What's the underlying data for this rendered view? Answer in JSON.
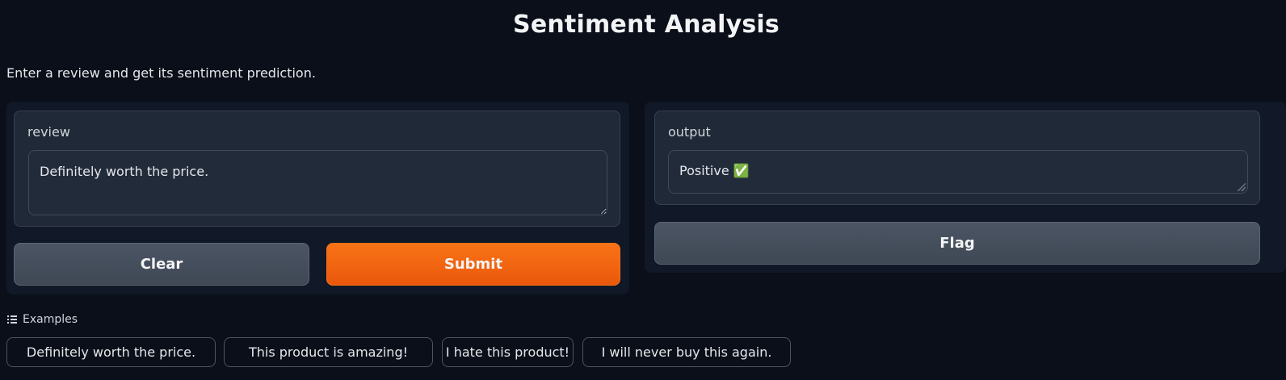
{
  "header": {
    "title": "Sentiment Analysis",
    "description": "Enter a review and get its sentiment prediction."
  },
  "input_panel": {
    "label": "review",
    "value": "Definitely worth the price.",
    "clear_label": "Clear",
    "submit_label": "Submit"
  },
  "output_panel": {
    "label": "output",
    "value": "Positive ✅",
    "flag_label": "Flag"
  },
  "examples": {
    "label": "Examples",
    "icon": "list-icon",
    "items": [
      "Definitely worth the price.",
      "This product is amazing!",
      "I hate this product!",
      "I will never buy this again."
    ]
  },
  "colors": {
    "background": "#0b0f19",
    "panel": "#111827",
    "block": "#1f2937",
    "accent": "#f97316",
    "secondary_button": "#4b5563"
  }
}
